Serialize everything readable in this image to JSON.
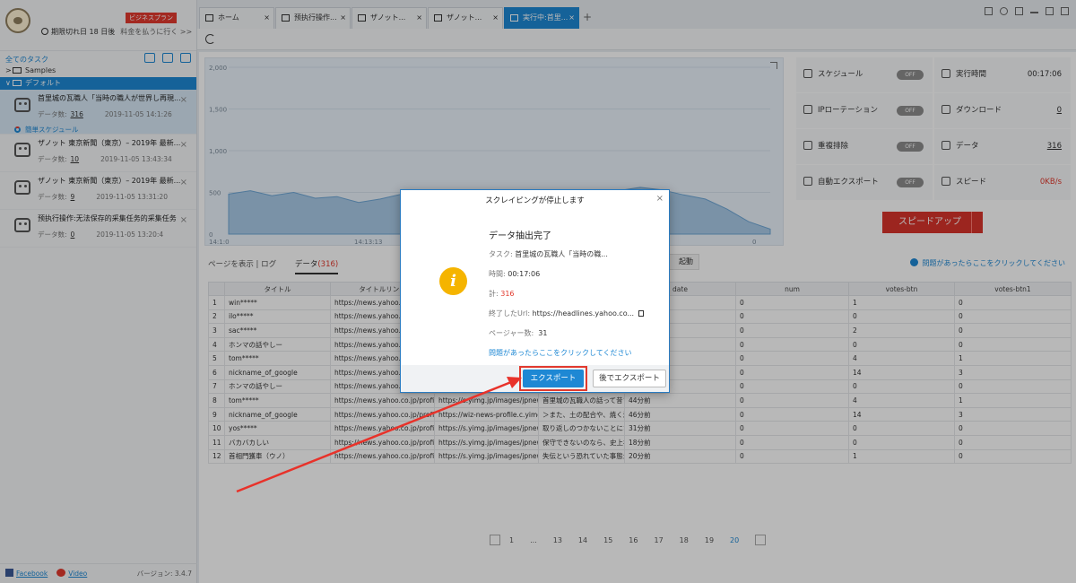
{
  "sidebar": {
    "plan_badge": "ビジネスプラン",
    "expiry_text": "期限切れ日 18 日後",
    "pay_link": "料金を払うに行く >>",
    "all_tasks": "全てのタスク",
    "folders": [
      {
        "caret": ">",
        "name": "Samples"
      },
      {
        "caret": "∨",
        "name": "デフォルト"
      }
    ],
    "tasks": [
      {
        "title": "首里城の瓦職人「当時の職人が世界し再現...",
        "count_label": "データ数:",
        "count": "316",
        "date": "2019-11-05 14:1:26",
        "sub": "簡単スケジュール"
      },
      {
        "title": "ザノット 東京新聞（東京）– 2019年 最新...",
        "count_label": "データ数:",
        "count": "10",
        "date": "2019-11-05 13:43:34"
      },
      {
        "title": "ザノット 東京新聞（東京）– 2019年 最新...",
        "count_label": "データ数:",
        "count": "9",
        "date": "2019-11-05 13:31:20"
      },
      {
        "title": "预执行操作:无法保存的采集任务的采集任务",
        "count_label": "データ数:",
        "count": "0",
        "date": "2019-11-05 13:20:4"
      }
    ],
    "footer": {
      "facebook": "Facebook",
      "video": "Video",
      "version": "バージョン: 3.4.7"
    }
  },
  "tabs": [
    {
      "label": "ホーム",
      "closable": true
    },
    {
      "label": "预执行操作...",
      "closable": true
    },
    {
      "label": "ザノット...",
      "closable": true
    },
    {
      "label": "ザノット...",
      "closable": true
    },
    {
      "label": "実行中:首里...",
      "closable": true,
      "active": true
    }
  ],
  "chart_data": {
    "type": "area",
    "y_ticks": [
      "2,000",
      "1,500",
      "1,000",
      "500",
      "0"
    ],
    "x_ticks": [
      "14:1:0",
      "14:13:13",
      "0"
    ],
    "ylim": [
      0,
      2000
    ],
    "values": [
      480,
      520,
      460,
      500,
      430,
      450,
      380,
      420,
      480,
      410,
      470,
      430,
      490,
      520,
      480,
      440,
      500,
      470,
      520,
      560,
      530,
      470,
      420,
      300,
      150,
      60
    ]
  },
  "stats": {
    "schedule": {
      "label": "スケジュール",
      "toggle": "OFF"
    },
    "ip_rotation": {
      "label": "IPローテーション",
      "toggle": "OFF"
    },
    "dedupe": {
      "label": "重複排除",
      "toggle": "OFF"
    },
    "auto_export": {
      "label": "自動エクスポート",
      "toggle": "OFF"
    },
    "runtime": {
      "label": "実行時間",
      "value": "00:17:06"
    },
    "download": {
      "label": "ダウンロード",
      "value": "0"
    },
    "data": {
      "label": "データ",
      "value": "316"
    },
    "speed": {
      "label": "スピード",
      "value": "0KB/s"
    },
    "speedup_button": "スピードアップ"
  },
  "view": {
    "page_view": "ページを表示",
    "log": "ログ",
    "data_tab": "データ",
    "data_count": "(316)",
    "shaded_btn": "起動",
    "help": "問題があったらここをクリックしてください"
  },
  "table": {
    "headers": [
      "",
      "タイトル",
      "タイトルリンク",
      "",
      "",
      "date",
      "num",
      "votes-btn",
      "votes-btn1"
    ],
    "rows": [
      [
        "1",
        "win*****",
        "https://news.yahoo.co...",
        "",
        "",
        "",
        "0",
        "1",
        "0"
      ],
      [
        "2",
        "ilo*****",
        "https://news.yahoo.co...",
        "",
        "",
        "",
        "0",
        "0",
        "0"
      ],
      [
        "3",
        "sac*****",
        "https://news.yahoo.co...",
        "",
        "",
        "",
        "0",
        "2",
        "0"
      ],
      [
        "4",
        "ホンマの話やしー",
        "https://news.yahoo.co...",
        "",
        "",
        "",
        "0",
        "0",
        "0"
      ],
      [
        "5",
        "tom*****",
        "https://news.yahoo.co...",
        "",
        "",
        "",
        "0",
        "4",
        "1"
      ],
      [
        "6",
        "nickname_of_google",
        "https://news.yahoo.co...",
        "",
        "",
        "",
        "0",
        "14",
        "3"
      ],
      [
        "7",
        "ホンマの話やしー",
        "https://news.yahoo.co...",
        "",
        "",
        "",
        "0",
        "0",
        "0"
      ],
      [
        "8",
        "tom*****",
        "https://news.yahoo.co.jp/profile/...",
        "https://s.yimg.jp/images/jpnews...",
        "首里城の瓦職人の話って昔プロ...",
        "44分前",
        "0",
        "4",
        "1"
      ],
      [
        "9",
        "nickname_of_google",
        "https://news.yahoo.co.jp/profile/...",
        "https://wiz-news-profile.c.yimg...",
        "＞また、土の配合や、焼く温度...",
        "46分前",
        "0",
        "14",
        "3"
      ],
      [
        "10",
        "yos*****",
        "https://news.yahoo.co.jp/profile/...",
        "https://s.yimg.jp/images/jpnews...",
        "取り返しのつかないことになっ...",
        "31分前",
        "0",
        "0",
        "0"
      ],
      [
        "11",
        "バカバカしい",
        "https://news.yahoo.co.jp/profile/...",
        "https://s.yimg.jp/images/jpnews...",
        "保守できないのなら、史上初...",
        "18分前",
        "0",
        "0",
        "0"
      ],
      [
        "12",
        "首相門獲車（ウノ）",
        "https://news.yahoo.co.jp/profile/...",
        "https://s.yimg.jp/images/jpnews...",
        "失伝という恐れていた事態が...",
        "20分前",
        "0",
        "1",
        "0"
      ]
    ]
  },
  "pager": {
    "pages": [
      "1",
      "...",
      "13",
      "14",
      "15",
      "16",
      "17",
      "18",
      "19",
      "20"
    ],
    "current": "20"
  },
  "modal": {
    "title": "スクレイピングが停止します",
    "heading": "データ抽出完了",
    "task_label": "タスク:",
    "task_value": "首里城の瓦職人「当時の職...",
    "time_label": "時間:",
    "time_value": "00:17:06",
    "total_label": "計:",
    "total_value": "316",
    "url_label": "終了したUrl:",
    "url_value": "https://headlines.yahoo.co...",
    "pages_label": "ページャー数:",
    "pages_value": "31",
    "help_link": "問題があったらここをクリックしてください",
    "export_button": "エクスポート",
    "later_button": "後でエクスポート"
  },
  "colors": {
    "accent": "#1e88d4",
    "alert": "#e23a2e",
    "info": "#f5b400"
  }
}
